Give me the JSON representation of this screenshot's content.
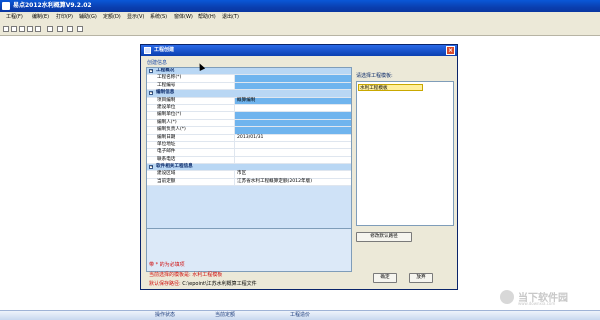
{
  "app": {
    "title": "易点2012水利概算V9.2.02",
    "menu": [
      "工程(F)",
      "编制(E)",
      "打印(P)",
      "辅助(G)",
      "定额(D)",
      "显示(V)",
      "系统(S)",
      "窗体(W)",
      "帮助(H)",
      "退出(T)"
    ],
    "status": [
      "操作状态",
      "当前定额",
      "工程造价"
    ]
  },
  "dialog": {
    "title": "工程创建",
    "subtitle": "创建信息",
    "groups": [
      {
        "label": "工程概况",
        "rows": [
          {
            "label": "工程名称(*)",
            "value": "",
            "highlight": true
          },
          {
            "label": "工程编号",
            "value": "",
            "highlight": true
          }
        ]
      },
      {
        "label": "编制信息",
        "rows": [
          {
            "label": "项目编制",
            "value": "概算编制",
            "highlight": true
          },
          {
            "label": "建设单位",
            "value": "",
            "highlight": false
          },
          {
            "label": "编制单位(*)",
            "value": "",
            "highlight": true
          },
          {
            "label": "编制人(*)",
            "value": "",
            "highlight": true
          },
          {
            "label": "编制负责人(*)",
            "value": "",
            "highlight": true
          },
          {
            "label": "编制日期",
            "value": "2013/01/31",
            "highlight": false
          },
          {
            "label": "单位地址",
            "value": "",
            "highlight": false
          },
          {
            "label": "电子邮件",
            "value": "",
            "highlight": false
          },
          {
            "label": "联系电话",
            "value": "",
            "highlight": false
          }
        ]
      },
      {
        "label": "软件相关工程信息",
        "rows": [
          {
            "label": "建设区域",
            "value": "市区",
            "highlight": false
          },
          {
            "label": "当前定额",
            "value": "江苏省水利工程概算定额(2012年版)",
            "highlight": false
          }
        ]
      }
    ],
    "note_required": "带 * 的为必填项",
    "note_template": "当前选择的模板是: 水利工程模板",
    "save_path_label": "默认保存路径:",
    "save_path_value": "C:\\epoint\\江苏水利概算工程文件",
    "template_label": "请选择工程模板:",
    "templates": [
      "水利工程模板"
    ],
    "btn_default_path": "修改默认路径",
    "btn_ok": "确定",
    "btn_cancel": "放弃"
  },
  "watermark": {
    "text": "当下软件园",
    "url": "www.downxia.com"
  }
}
